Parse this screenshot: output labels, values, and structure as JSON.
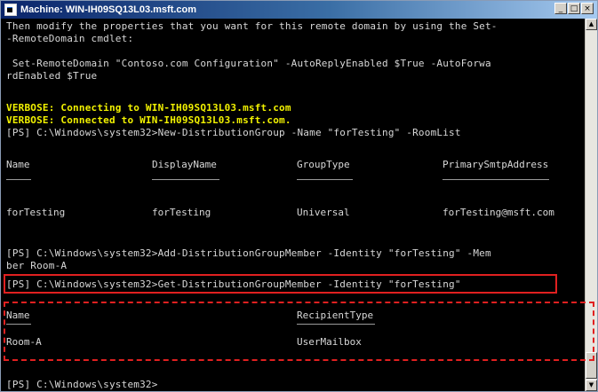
{
  "window": {
    "title": "Machine: WIN-IH09SQ13L03.msft.com",
    "controls": {
      "minimize": "_",
      "restore": "□",
      "close": "×"
    }
  },
  "console": {
    "lines": [
      "Then modify the properties that you want for this remote domain by using the Set-",
      "-RemoteDomain cmdlet:",
      "",
      " Set-RemoteDomain \"Contoso.com Configuration\" -AutoReplyEnabled $True -AutoForwa",
      "rdEnabled $True",
      "",
      "VERBOSE: Connecting to WIN-IH09SQ13L03.msft.com",
      "VERBOSE: Connected to WIN-IH09SQ13L03.msft.com.",
      "[PS] C:\\Windows\\system32>New-DistributionGroup -Name \"forTesting\" -RoomList",
      "[PS] C:\\Windows\\system32>Add-DistributionGroupMember -Identity \"forTesting\" -Mem",
      "ber Room-A",
      "[PS] C:\\Windows\\system32>Get-DistributionGroupMember -Identity \"forTesting\"",
      "[PS] C:\\Windows\\system32>"
    ],
    "group_table": {
      "headers": [
        "Name",
        "DisplayName",
        "GroupType",
        "PrimarySmtpAddress"
      ],
      "row": [
        "forTesting",
        "forTesting",
        "Universal",
        "forTesting@msft.com"
      ]
    },
    "member_table": {
      "headers": [
        "Name",
        "RecipientType"
      ],
      "row": [
        "Room-A",
        "UserMailbox"
      ]
    }
  },
  "colors": {
    "console_bg": "#000000",
    "console_text": "#d8d8d8",
    "verbose_text": "#f2f200",
    "highlight": "#e02020",
    "titlebar_start": "#0a246a",
    "titlebar_end": "#a6caf0"
  },
  "icons": [
    "console-app-icon",
    "minimize-icon",
    "restore-icon",
    "close-icon",
    "scroll-up-icon",
    "scroll-down-icon"
  ]
}
